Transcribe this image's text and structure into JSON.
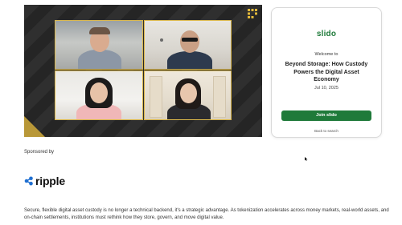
{
  "video": {
    "brand_icon": "grid-logo-icon",
    "accent_color": "#d8b54a",
    "participants": [
      {
        "name": "participant-1"
      },
      {
        "name": "participant-2"
      },
      {
        "name": "participant-3"
      },
      {
        "name": "participant-4"
      }
    ]
  },
  "slido": {
    "logo": "slido",
    "welcome": "Welcome to",
    "event_title": "Beyond Storage: How Custody Powers the Digital Asset Economy",
    "date": "Jul 10, 2025",
    "join_label": "Join slido",
    "back_label": "Back to search",
    "brand_color": "#1f7a3a"
  },
  "sponsor": {
    "label": "Sponsored by",
    "logo_text": "ripple",
    "logo_icon": "ripple-mark-icon"
  },
  "description": "Secure, flexible digital asset custody is no longer a technical backend, it's a strategic advantage. As tokenization accelerates across money markets, real-world assets, and on-chain settlements, institutions must rethink how they store, govern, and move digital value."
}
